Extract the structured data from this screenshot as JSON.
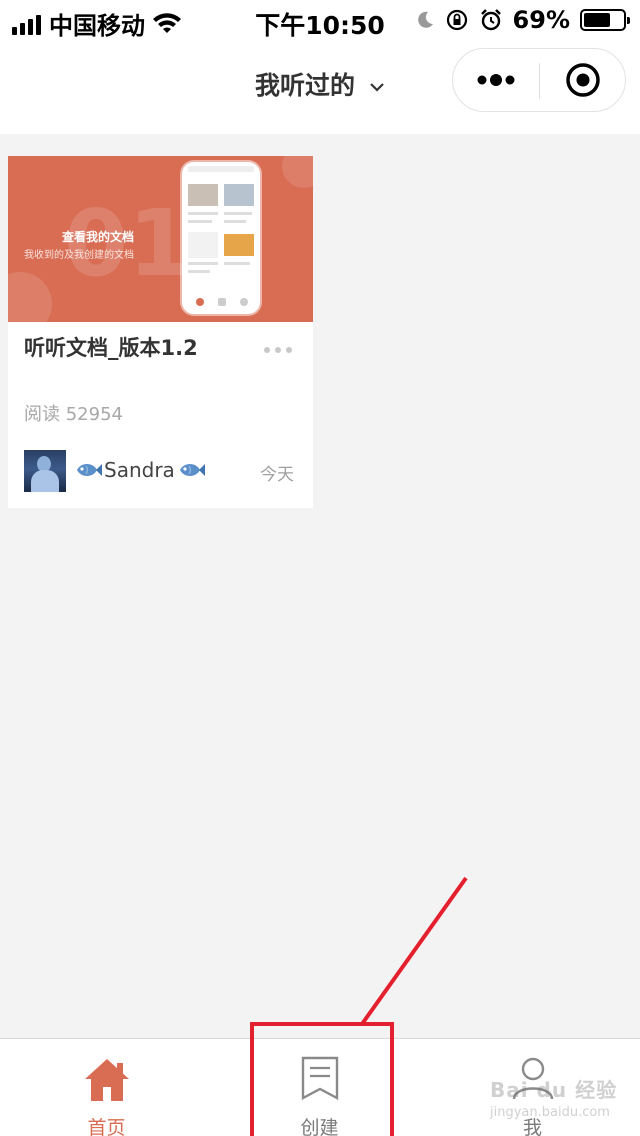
{
  "status_bar": {
    "carrier": "中国移动",
    "time": "下午10:50",
    "battery": "69%",
    "battery_level": 0.69
  },
  "nav": {
    "title": "我听过的"
  },
  "card": {
    "cover": {
      "heading": "查看我的文档",
      "subheading": "我收到的及我创建的文档",
      "big_number": "01"
    },
    "title": "听听文档_版本1.2",
    "reads": "阅读 52954",
    "author": "Sandra",
    "date": "今天"
  },
  "tabbar": {
    "tabs": [
      {
        "label": "首页",
        "icon": "home-icon",
        "active": true
      },
      {
        "label": "创建",
        "icon": "document-icon",
        "active": false
      },
      {
        "label": "我",
        "icon": "user-icon",
        "active": false
      }
    ]
  },
  "colors": {
    "accent": "#d96d54",
    "annotation": "#e5202e"
  },
  "watermark": {
    "text": "Bai du 经验",
    "sub": "jingyan.baidu.com"
  }
}
